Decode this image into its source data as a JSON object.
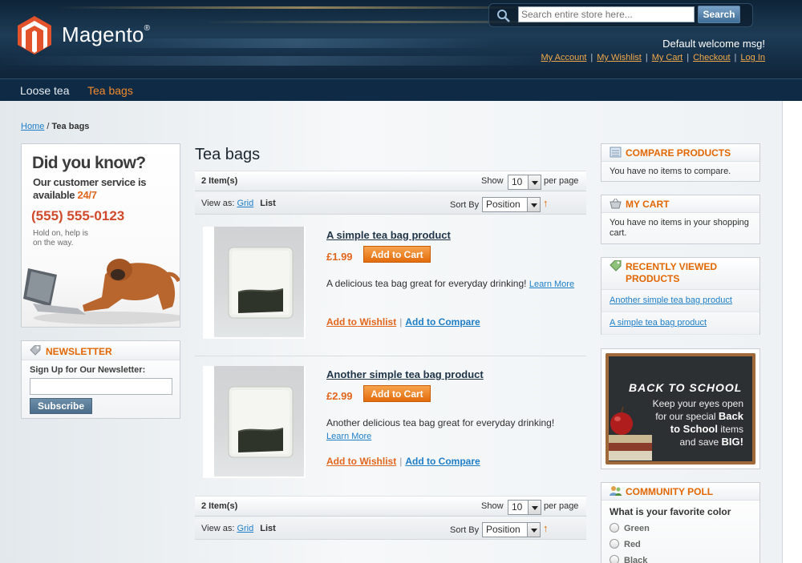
{
  "header": {
    "logo_text": "Magento",
    "logo_reg": "®",
    "search_placeholder": "Search entire store here...",
    "search_button": "Search",
    "welcome": "Default welcome msg!",
    "links": [
      "My Account",
      "My Wishlist",
      "My Cart",
      "Checkout",
      "Log In"
    ]
  },
  "nav": {
    "items": [
      "Loose tea",
      "Tea bags"
    ],
    "active": "Tea bags"
  },
  "breadcrumb": {
    "home": "Home",
    "separator": "/",
    "current": "Tea bags"
  },
  "ad_left": {
    "title": "Did you know?",
    "line1": "Our customer service is",
    "line2": "available",
    "highlight": "24/7",
    "phone": "(555) 555-0123",
    "hold_line1": "Hold on, help is",
    "hold_line2": "on the way."
  },
  "newsletter": {
    "title": "NEWSLETTER",
    "label": "Sign Up for Our Newsletter:",
    "button": "Subscribe"
  },
  "category": {
    "title": "Tea bags",
    "toolbar": {
      "amount": "2 Item(s)",
      "show": "Show",
      "limit": "10",
      "per_page": "per page",
      "view_as": "View as:",
      "grid": "Grid",
      "list": "List",
      "sort_by": "Sort By",
      "sort_value": "Position",
      "sort_arrow": "↑"
    },
    "products": [
      {
        "name": "A simple tea bag product",
        "price": "£1.99",
        "add_to_cart": "Add to Cart",
        "description": "A delicious tea bag great for everyday drinking!",
        "learn_more": "Learn More",
        "wishlist": "Add to Wishlist",
        "compare": "Add to Compare"
      },
      {
        "name": "Another simple tea bag product",
        "price": "£2.99",
        "add_to_cart": "Add to Cart",
        "description": "Another delicious tea bag great for everyday drinking!",
        "learn_more": "Learn More",
        "wishlist": "Add to Wishlist",
        "compare": "Add to Compare"
      }
    ]
  },
  "sidebar_right": {
    "compare": {
      "title": "COMPARE PRODUCTS",
      "text": "You have no items to compare."
    },
    "cart": {
      "title": "MY CART",
      "text": "You have no items in your shopping cart."
    },
    "recent": {
      "title_line1": "RECENTLY VIEWED",
      "title_line2": "PRODUCTS",
      "items": [
        "Another simple tea bag product",
        "A simple tea bag product"
      ]
    },
    "promo": {
      "title": "BACK TO SCHOOL",
      "line1": "Keep your eyes open",
      "line2": "for our special",
      "bold1": "Back",
      "bold2": "to School",
      "line3": "items",
      "line4": "and save",
      "bold3": "BIG!"
    },
    "poll": {
      "title": "COMMUNITY POLL",
      "question": "What is your favorite color",
      "options": [
        "Green",
        "Red",
        "Black"
      ]
    }
  },
  "colors": {
    "accent": "#e26703",
    "link": "#1e7ec8",
    "header_bg": "#1d3c56",
    "nav_bg": "#0e2a44"
  }
}
